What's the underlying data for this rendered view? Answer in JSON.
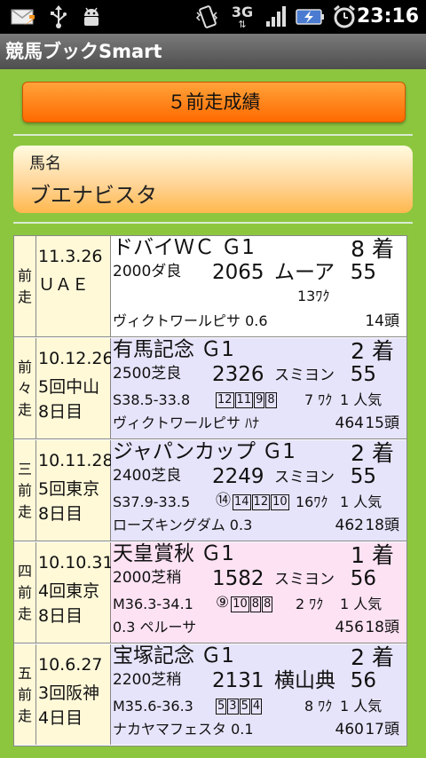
{
  "status_bar": {
    "time": "23:16",
    "network": "3G",
    "icons": [
      "mail-icon",
      "usb-icon",
      "android-debug-icon",
      "vibrate-icon",
      "network-3g-icon",
      "signal-icon",
      "battery-charging-icon",
      "alarm-icon"
    ]
  },
  "app": {
    "title": "競馬ブックSmart"
  },
  "header_button": {
    "label": "５前走成績"
  },
  "horse": {
    "label": "馬名",
    "name": "ブエナビスタ"
  },
  "races": [
    {
      "label_chars": [
        "前",
        "走"
      ],
      "date": "11.3.26",
      "venue": "ＵＡＥ",
      "day": "",
      "race": "ドバイＷＣ Ｇ1",
      "rank": "8 着",
      "distance": "2000ダ良",
      "time": "2065",
      "jockey": "ムーア",
      "weight": "55",
      "margin": "13ﾜｸ",
      "winner": "ヴィクトワールピサ 0.6",
      "body_weight": "",
      "heads": "14頭"
    },
    {
      "label_chars": [
        "前",
        "々",
        "走"
      ],
      "date": "10.12.26",
      "venue": "5回中山",
      "day": "8日目",
      "race": "有馬記念 Ｇ1",
      "rank": "2 着",
      "distance": "2500芝良",
      "time": "2326",
      "jockey": "スミヨン",
      "weight": "55",
      "splits": "S38.5-33.8",
      "corner_circle": "",
      "corners": [
        "12",
        "11",
        "9",
        "8"
      ],
      "frame": "7 ﾜｸ",
      "popularity": "1 人気",
      "winner": "ヴィクトワールピサ ﾊﾅ",
      "body_weight": "464",
      "heads": "15頭"
    },
    {
      "label_chars": [
        "三",
        "前",
        "走"
      ],
      "date": "10.11.28",
      "venue": "5回東京",
      "day": "8日目",
      "race": "ジャパンカップ Ｇ1",
      "rank": "2 着",
      "distance": "2400芝良",
      "time": "2249",
      "jockey": "スミヨン",
      "weight": "55",
      "splits": "S37.9-33.5",
      "corner_circle": "⑭",
      "corners": [
        "14",
        "12",
        "10"
      ],
      "frame": "16ﾜｸ",
      "popularity": "1 人気",
      "winner": "ローズキングダム 0.3",
      "body_weight": "462",
      "heads": "18頭"
    },
    {
      "label_chars": [
        "四",
        "前",
        "走"
      ],
      "date": "10.10.31",
      "venue": "4回東京",
      "day": "8日目",
      "race": "天皇賞秋 Ｇ1",
      "rank": "1 着",
      "distance": "2000芝稍",
      "time": "1582",
      "jockey": "スミヨン",
      "weight": "56",
      "splits": "M36.3-34.1",
      "corner_circle": "⑨",
      "corners": [
        "10",
        "8",
        "8"
      ],
      "frame": "2 ﾜｸ",
      "popularity": "1 人気",
      "winner": "0.3 ペルーサ",
      "body_weight": "456",
      "heads": "18頭"
    },
    {
      "label_chars": [
        "五",
        "前",
        "走"
      ],
      "date": "10.6.27",
      "venue": "3回阪神",
      "day": "4日目",
      "race": "宝塚記念 Ｇ1",
      "rank": "2 着",
      "distance": "2200芝稍",
      "time": "2131",
      "jockey": "横山典",
      "weight": "56",
      "splits": "M35.6-36.3",
      "corner_circle": "",
      "corners": [
        "5",
        "3",
        "5",
        "4"
      ],
      "frame": "8 ﾜｸ",
      "popularity": "1 人気",
      "winner": "ナカヤマフェスタ 0.1",
      "body_weight": "460",
      "heads": "17頭"
    }
  ],
  "colors": {
    "background": "#8cc63f",
    "button": "#ff7f1a",
    "row_label_bg": "#fff9d8",
    "row_bg": [
      "#ffffff",
      "#e6e4fa",
      "#e6e4fa",
      "#fde2f4",
      "#e6e4fa"
    ]
  }
}
